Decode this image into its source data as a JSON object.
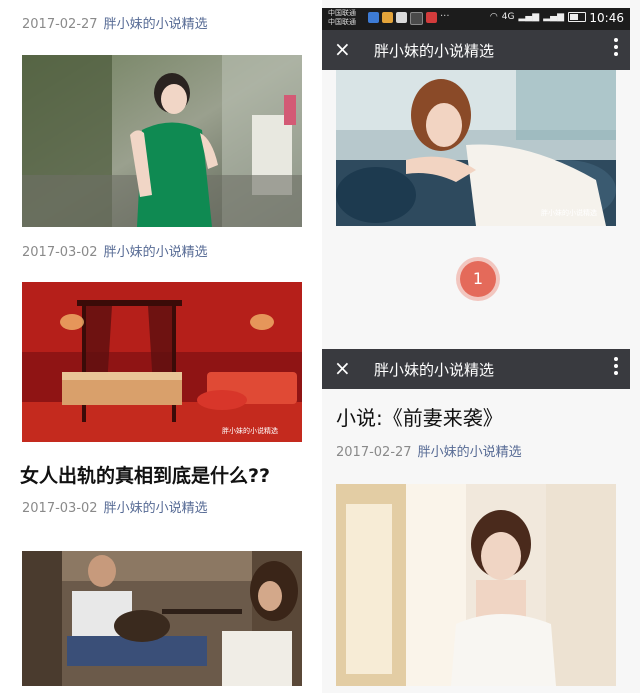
{
  "left_feed": {
    "articles": [
      {
        "date": "2017-02-27",
        "author": "胖小妹的小说精选"
      },
      {
        "date": "2017-03-02",
        "author": "胖小妹的小说精选"
      },
      {
        "date": "2017-03-02",
        "author": "胖小妹的小说精选",
        "headline": "女人出轨的真相到底是什么??"
      }
    ],
    "watermark": "胖小妹的小说精选"
  },
  "right_top": {
    "status": {
      "carrier_1": "中国联通",
      "carrier_2": "中国联通",
      "dots": "···",
      "network": "4G",
      "time": "10:46"
    },
    "nav_title": "胖小妹的小说精选",
    "close_icon": "×",
    "badge": "1"
  },
  "right_bottom": {
    "nav_title": "胖小妹的小说精选",
    "close_icon": "×",
    "article_title": "小说:《前妻来袭》",
    "date": "2017-02-27",
    "author": "胖小妹的小说精选"
  },
  "colors": {
    "nav_bg": "#393a3f",
    "author_link": "#576b95",
    "badge": "#e46a5a"
  }
}
